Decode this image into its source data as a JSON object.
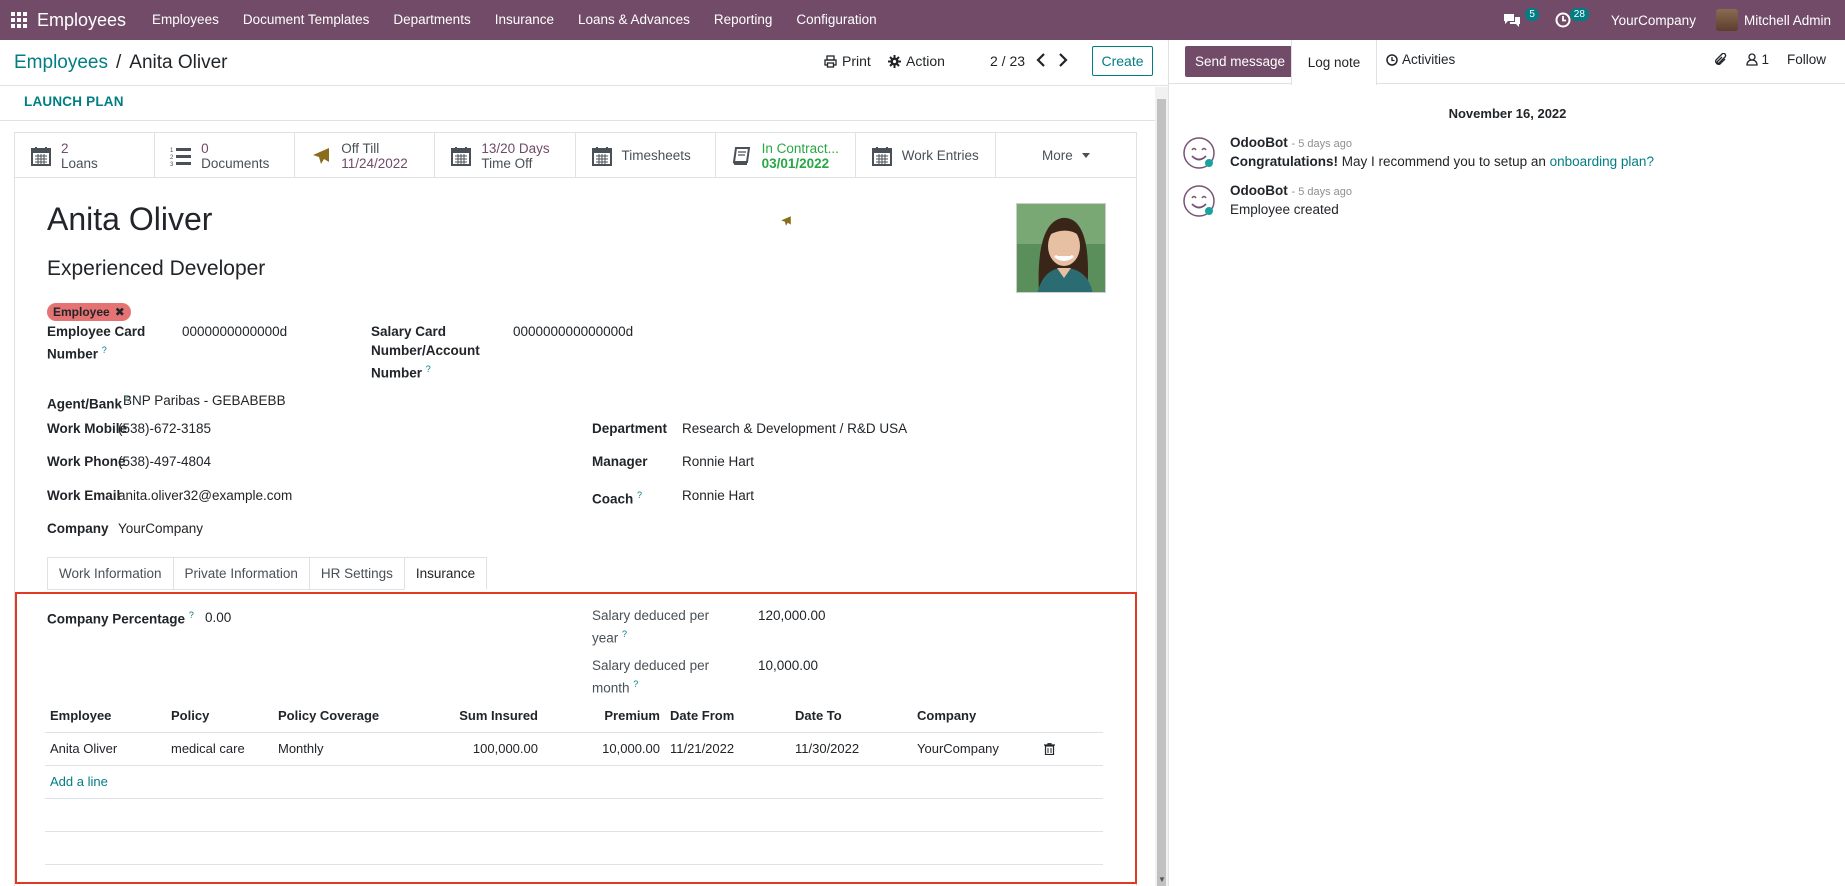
{
  "nav": {
    "app_title": "Employees",
    "menu": [
      "Employees",
      "Document Templates",
      "Departments",
      "Insurance",
      "Loans & Advances",
      "Reporting",
      "Configuration"
    ],
    "messages_count": "5",
    "activities_count": "28",
    "company": "YourCompany",
    "user": "Mitchell Admin"
  },
  "control": {
    "breadcrumb_parent": "Employees",
    "breadcrumb_sep": "/",
    "breadcrumb_current": "Anita Oliver",
    "print_label": "Print",
    "action_label": "Action",
    "pager": "2 / 23",
    "create_label": "Create"
  },
  "launch_plan": "LAUNCH PLAN",
  "smart_buttons": {
    "loans_value": "2",
    "loans_label": "Loans",
    "documents_value": "0",
    "documents_label": "Documents",
    "offtill_label": "Off Till",
    "offtill_value": "11/24/2022",
    "timeoff_value": "13/20 Days",
    "timeoff_label": "Time Off",
    "timesheets_label": "Timesheets",
    "contract_label": "In Contract...",
    "contract_value": "03/01/2022",
    "workentries_label": "Work Entries",
    "more_label": "More"
  },
  "employee": {
    "name": "Anita Oliver",
    "job_title": "Experienced Developer",
    "tag": "Employee",
    "card_number_label_1": "Employee Card",
    "card_number_label_2": "Number",
    "card_number": "0000000000000d",
    "salary_card_label_1": "Salary Card",
    "salary_card_label_2": "Number/Account",
    "salary_card_label_3": "Number",
    "salary_card": "000000000000000d",
    "agent_bank_label": "Agent/Bank",
    "agent_bank": "BNP Paribas - GEBABEBB",
    "work_mobile_label": "Work Mobile",
    "work_mobile": "(538)-672-3185",
    "work_phone_label": "Work Phone",
    "work_phone": "(538)-497-4804",
    "work_email_label": "Work Email",
    "work_email": "anita.oliver32@example.com",
    "company_label": "Company",
    "company": "YourCompany",
    "department_label": "Department",
    "department": "Research & Development / R&D USA",
    "manager_label": "Manager",
    "manager": "Ronnie Hart",
    "coach_label": "Coach",
    "coach": "Ronnie Hart"
  },
  "tabs": [
    "Work Information",
    "Private Information",
    "HR Settings",
    "Insurance"
  ],
  "insurance": {
    "company_percentage_label": "Company Percentage",
    "company_percentage": "0.00",
    "salary_year_label_1": "Salary deduced per",
    "salary_year_label_2": "year",
    "salary_year": "120,000.00",
    "salary_month_label_1": "Salary deduced per",
    "salary_month_label_2": "month",
    "salary_month": "10,000.00",
    "columns": [
      "Employee",
      "Policy",
      "Policy Coverage",
      "Sum Insured",
      "Premium",
      "Date From",
      "Date To",
      "Company"
    ],
    "rows": [
      [
        "Anita Oliver",
        "medical care",
        "Monthly",
        "100,000.00",
        "10,000.00",
        "11/21/2022",
        "11/30/2022",
        "YourCompany"
      ]
    ],
    "add_line": "Add a line"
  },
  "chatter": {
    "send_message": "Send message",
    "log_note": "Log note",
    "activities": "Activities",
    "followers_count": "1",
    "follow": "Follow",
    "date": "November 16, 2022",
    "messages": [
      {
        "author": "OdooBot",
        "time": "- 5 days ago",
        "bold": "Congratulations!",
        "text": " May I recommend you to setup an ",
        "link": "onboarding plan?"
      },
      {
        "author": "OdooBot",
        "time": "- 5 days ago",
        "text": "Employee created"
      }
    ]
  },
  "colors": {
    "brand": "#714b67",
    "accent": "#017e84",
    "highlight": "#e03a22",
    "tag": "#e57373"
  }
}
